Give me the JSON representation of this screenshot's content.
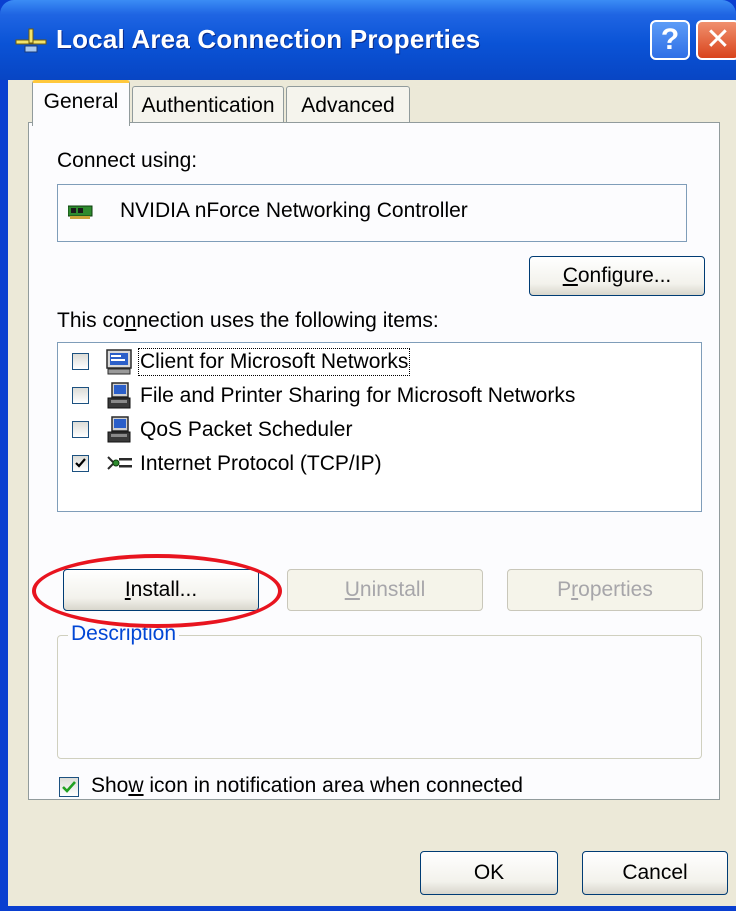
{
  "window": {
    "title": "Local Area Connection Properties",
    "help_label": "?",
    "close_label": "✕"
  },
  "tabs": [
    {
      "label": "General",
      "active": true
    },
    {
      "label": "Authentication",
      "active": false
    },
    {
      "label": "Advanced",
      "active": false
    }
  ],
  "general": {
    "connect_using_label": "Connect using:",
    "adapter_name": "NVIDIA nForce Networking Controller",
    "configure_button": {
      "pre": "",
      "mnemonic": "C",
      "post": "onfigure..."
    },
    "items_label": {
      "pre": "This co",
      "mnemonic": "n",
      "post": "nection uses the following items:"
    },
    "components": [
      {
        "label": "Client for Microsoft Networks",
        "checked": false,
        "icon": "network-client-icon"
      },
      {
        "label": "File and Printer Sharing for Microsoft Networks",
        "checked": false,
        "icon": "network-service-icon"
      },
      {
        "label": "QoS Packet Scheduler",
        "checked": false,
        "icon": "network-service-icon"
      },
      {
        "label": "Internet Protocol (TCP/IP)",
        "checked": true,
        "icon": "network-protocol-icon"
      }
    ],
    "install_button": {
      "pre": "",
      "mnemonic": "I",
      "post": "nstall..."
    },
    "uninstall_button": {
      "pre": "",
      "mnemonic": "U",
      "post": "ninstall"
    },
    "properties_button": {
      "pre": "P",
      "mnemonic": "r",
      "post": "operties"
    },
    "description_title": "Description",
    "show_icon": {
      "pre": "Sho",
      "mnemonic": "w",
      "post": " icon in notification area when connected",
      "checked": true
    }
  },
  "footer": {
    "ok_label": "OK",
    "cancel_label": "Cancel"
  },
  "colors": {
    "titlebar": "#0a53d6",
    "highlight": "#e8141f",
    "dialog_face": "#ece9d8"
  }
}
